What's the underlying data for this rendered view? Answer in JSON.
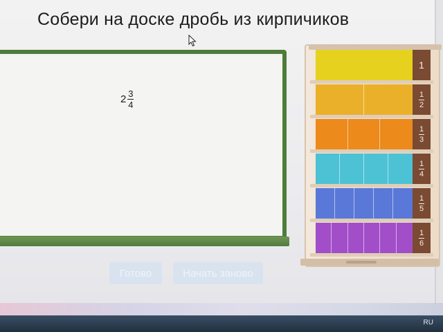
{
  "app": {
    "title": "Собери на доске дробь из кирпичиков"
  },
  "board": {
    "fraction": {
      "whole": "2",
      "numerator": "3",
      "denominator": "4"
    }
  },
  "buttons": {
    "ready_label": "Готово",
    "reset_label": "Начать заново"
  },
  "shelf": {
    "rows": [
      {
        "color": "#e6d21e",
        "parts": 1,
        "label": {
          "numerator": "1",
          "denominator": ""
        }
      },
      {
        "color": "#ebb02a",
        "parts": 2,
        "label": {
          "numerator": "1",
          "denominator": "2"
        }
      },
      {
        "color": "#ec8a1c",
        "parts": 3,
        "label": {
          "numerator": "1",
          "denominator": "3"
        }
      },
      {
        "color": "#4cc2d4",
        "parts": 4,
        "label": {
          "numerator": "1",
          "denominator": "4"
        }
      },
      {
        "color": "#5a78d8",
        "parts": 5,
        "label": {
          "numerator": "1",
          "denominator": "5"
        }
      },
      {
        "color": "#a24ec8",
        "parts": 6,
        "label": {
          "numerator": "1",
          "denominator": "6"
        }
      }
    ],
    "label_bg": "#7a4a32"
  },
  "taskbar": {
    "language": "RU"
  }
}
